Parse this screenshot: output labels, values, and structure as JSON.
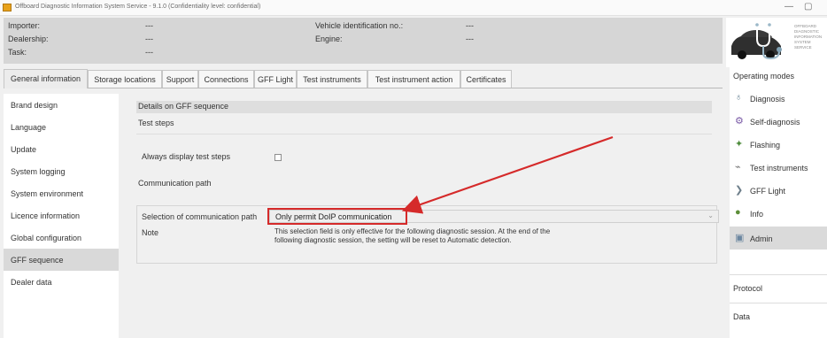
{
  "window": {
    "title": "Offboard Diagnostic Information System Service - 9.1.0 (Confidentiality level: confidential)",
    "controls": {
      "minimize": "—",
      "maximize": "▢"
    }
  },
  "vehicle_info": {
    "importer_label": "Importer:",
    "importer_value": "---",
    "dealership_label": "Dealership:",
    "dealership_value": "---",
    "task_label": "Task:",
    "task_value": "---",
    "vin_label": "Vehicle identification no.:",
    "vin_value": "---",
    "engine_label": "Engine:",
    "engine_value": "---"
  },
  "logo": {
    "text": "Offboard Diagnostic Information System Service",
    "icon": "car-stethoscope-icon"
  },
  "tabs": [
    {
      "label": "General information",
      "active": true
    },
    {
      "label": "Storage locations"
    },
    {
      "label": "Support"
    },
    {
      "label": "Connections"
    },
    {
      "label": "GFF Light"
    },
    {
      "label": "Test instruments"
    },
    {
      "label": "Test instrument action"
    },
    {
      "label": "Certificates"
    }
  ],
  "nav": {
    "items": [
      {
        "label": "Brand design"
      },
      {
        "label": "Language"
      },
      {
        "label": "Update"
      },
      {
        "label": "System logging"
      },
      {
        "label": "System environment"
      },
      {
        "label": "Licence information"
      },
      {
        "label": "Global configuration"
      },
      {
        "label": "GFF sequence",
        "active": true
      },
      {
        "label": "Dealer data"
      }
    ]
  },
  "details": {
    "header": "Details on GFF sequence",
    "test_steps_title": "Test steps",
    "always_display_label": "Always display test steps",
    "always_display_checked": false,
    "comm_path_title": "Communication path",
    "selection_label": "Selection of communication path",
    "selection_value": "Only permit DoIP communication",
    "note_label": "Note",
    "note_text": "This selection field is only effective for the following diagnostic session. At the end of the following diagnostic session, the setting will be reset to Automatic detection."
  },
  "annotation": {
    "highlight_color": "#d52a2a",
    "arrow_color": "#d52a2a"
  },
  "operating_modes": {
    "title": "Operating modes",
    "items": [
      {
        "label": "Diagnosis",
        "icon": "stethoscope-icon"
      },
      {
        "label": "Self-diagnosis",
        "icon": "self-diagnosis-icon"
      },
      {
        "label": "Flashing",
        "icon": "flashing-icon"
      },
      {
        "label": "Test instruments",
        "icon": "test-instruments-icon"
      },
      {
        "label": "GFF Light",
        "icon": "gff-light-icon"
      },
      {
        "label": "Info",
        "icon": "info-globe-icon"
      },
      {
        "label": "Admin",
        "icon": "admin-icon",
        "active": true
      }
    ],
    "protocol_label": "Protocol",
    "data_label": "Data"
  }
}
